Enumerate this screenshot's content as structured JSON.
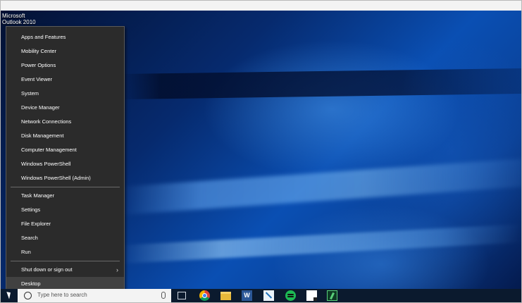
{
  "desktop": {
    "icon_label_line1": "Microsoft",
    "icon_label_line2": "Outlook 2010"
  },
  "context_menu": {
    "items": [
      {
        "label": "Apps and Features"
      },
      {
        "label": "Mobility Center"
      },
      {
        "label": "Power Options"
      },
      {
        "label": "Event Viewer"
      },
      {
        "label": "System"
      },
      {
        "label": "Device Manager"
      },
      {
        "label": "Network Connections"
      },
      {
        "label": "Disk Management"
      },
      {
        "label": "Computer Management"
      },
      {
        "label": "Windows PowerShell"
      },
      {
        "label": "Windows PowerShell (Admin)"
      },
      {
        "label": "Task Manager"
      },
      {
        "label": "Settings"
      },
      {
        "label": "File Explorer"
      },
      {
        "label": "Search"
      },
      {
        "label": "Run"
      },
      {
        "label": "Shut down or sign out"
      },
      {
        "label": "Desktop"
      }
    ],
    "submenu_indicator": "›",
    "hovered_item": "Desktop"
  },
  "taskbar": {
    "search_placeholder": "Type here to search",
    "icons": [
      "task-view-icon",
      "chrome-icon",
      "file-explorer-icon",
      "word-icon",
      "snipping-tool-icon",
      "spotify-icon",
      "sticky-notes-icon",
      "app-icon"
    ],
    "word_glyph": "W"
  },
  "colors": {
    "menu_background": "#2b2b2b",
    "menu_hover": "#414141",
    "taskbar": "#0b1a2e",
    "accent_blue": "#0a4fb3"
  }
}
